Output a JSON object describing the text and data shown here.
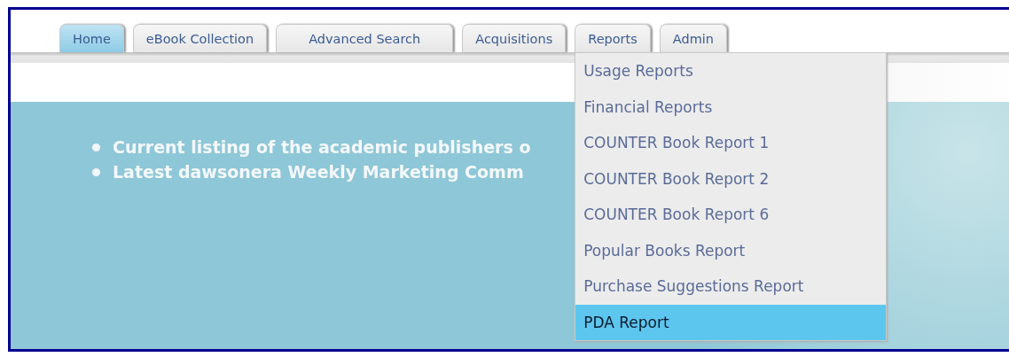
{
  "tabs": [
    {
      "label": "Home",
      "selected": true
    },
    {
      "label": "eBook Collection",
      "selected": false
    },
    {
      "label": "Advanced Search",
      "selected": false
    },
    {
      "label": "Acquisitions",
      "selected": false
    },
    {
      "label": "Reports",
      "selected": false,
      "expanded": true,
      "menu": [
        {
          "label": "Usage Reports",
          "selected": false
        },
        {
          "label": "Financial Reports",
          "selected": false
        },
        {
          "label": "COUNTER Book Report 1",
          "selected": false
        },
        {
          "label": "COUNTER Book Report 2",
          "selected": false
        },
        {
          "label": "COUNTER Book Report 6",
          "selected": false
        },
        {
          "label": "Popular Books Report",
          "selected": false
        },
        {
          "label": "Purchase Suggestions Report",
          "selected": false
        },
        {
          "label": "PDA Report",
          "selected": true
        }
      ]
    },
    {
      "label": "Admin",
      "selected": false
    }
  ],
  "bullets": [
    "Current listing of the academic publishers o",
    "Latest dawsonera Weekly Marketing Comm"
  ]
}
